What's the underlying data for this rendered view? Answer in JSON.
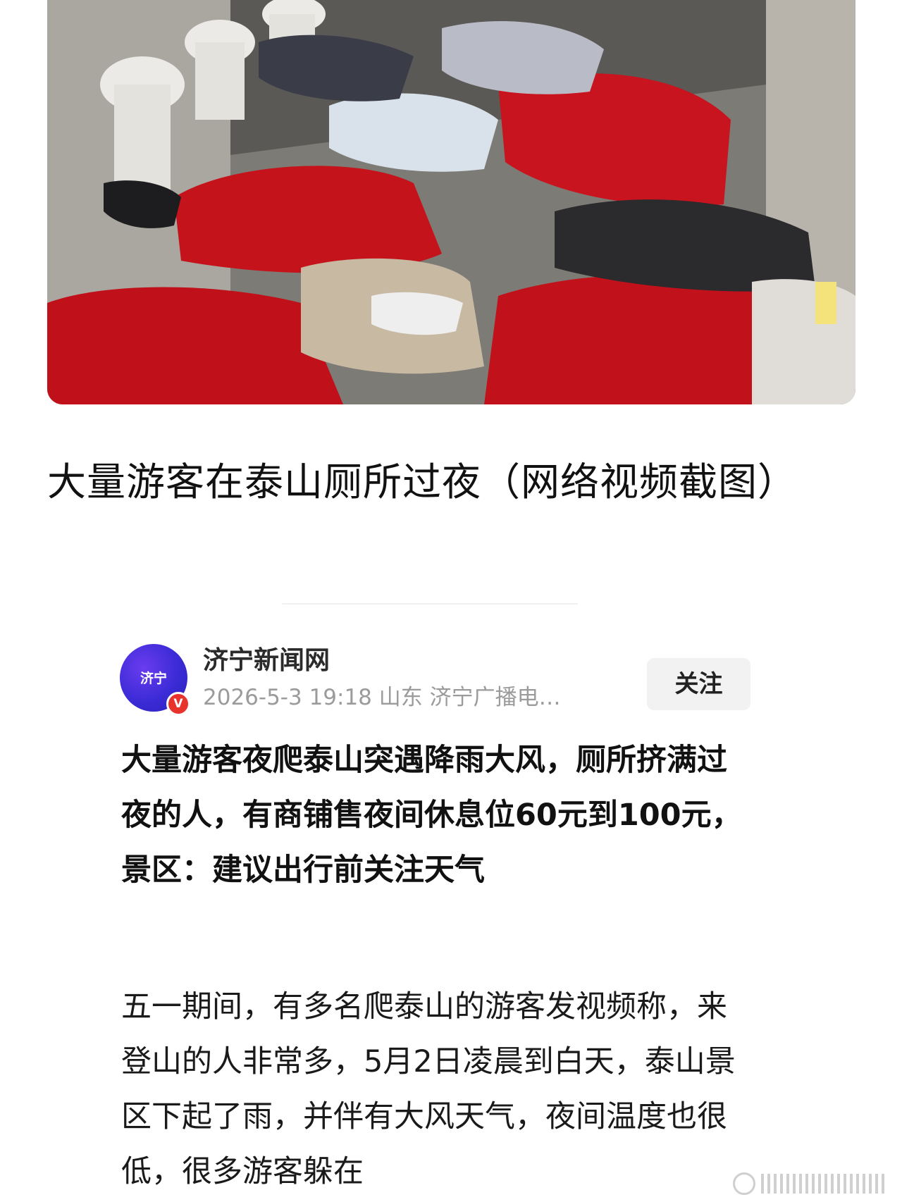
{
  "photo": {
    "icon": "news-photo-people-sleeping-in-restroom"
  },
  "caption": {
    "text": "大量游客在泰山厕所过夜（网络视频截图）"
  },
  "author": {
    "avatar_text": "济宁",
    "badge": "V",
    "name": "济宁新闻网",
    "meta": "2026-5-3 19:18 山东 济宁广播电…",
    "follow_label": "关注"
  },
  "article": {
    "headline": "大量游客夜爬泰山突遇降雨大风，厕所挤满过夜的人，有商铺售夜间休息位60元到100元，景区：建议出行前关注天气",
    "body": "五一期间，有多名爬泰山的游客发视频称，来登山的人非常多，5月2日凌晨到白天，泰山景区下起了雨，并伴有大风天气，夜间温度也很低，很多游客躲在"
  },
  "colors": {
    "accent_red": "#e8322c",
    "avatar_purple": "#3b2bd6",
    "meta_gray": "#9b9b9b"
  }
}
